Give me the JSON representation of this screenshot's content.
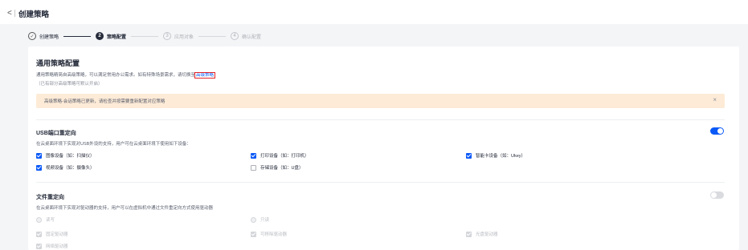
{
  "header": {
    "back_glyph": "<",
    "title": "创建策略"
  },
  "steps": [
    {
      "num": "✓",
      "label": "创建策略",
      "state": "done"
    },
    {
      "num": "2",
      "label": "策略配置",
      "state": "active"
    },
    {
      "num": "3",
      "label": "应用对象",
      "state": "todo"
    },
    {
      "num": "4",
      "label": "确认配置",
      "state": "todo"
    }
  ],
  "general": {
    "title": "通用策略配置",
    "desc_prefix": "通用策略精简自高级策略，可以满足常用办公需求。如有特殊场景需求，请切换至",
    "desc_link": "高级策略",
    "note": "（已有部分高级策略可默认开启）"
  },
  "alert": {
    "text": "高级策略-会话策略已更新，请检查并按需要重新配置对应策略",
    "close": "×"
  },
  "usb": {
    "title": "USB端口重定向",
    "enabled": true,
    "desc": "在云桌面环境下实现对USB外设的支持，用户可在云桌面环境下使用如下设备：",
    "options": [
      {
        "label": "图像设备（如：扫描仪）",
        "checked": true
      },
      {
        "label": "打印设备（如：打印机）",
        "checked": true
      },
      {
        "label": "智能卡设备（如：Ukey）",
        "checked": true
      },
      {
        "label": "视频设备（如：摄像头）",
        "checked": true
      },
      {
        "label": "存储设备（如：U盘）",
        "checked": false
      }
    ]
  },
  "file": {
    "title": "文件重定向",
    "enabled": false,
    "desc": "在云桌面环境下实现对驱动器的支持，用户可以在虚拟机中通过文件重定向方式使用驱动器",
    "radios": [
      {
        "label": "读写"
      },
      {
        "label": "只读"
      }
    ],
    "options": [
      {
        "label": "固定驱动器"
      },
      {
        "label": "可移除驱动器"
      },
      {
        "label": "光盘驱动器"
      },
      {
        "label": "网络驱动器"
      }
    ]
  },
  "colors": {
    "accent": "#0a59f7",
    "alert_bg": "#fdebd7",
    "highlight_border": "#e5252a"
  }
}
